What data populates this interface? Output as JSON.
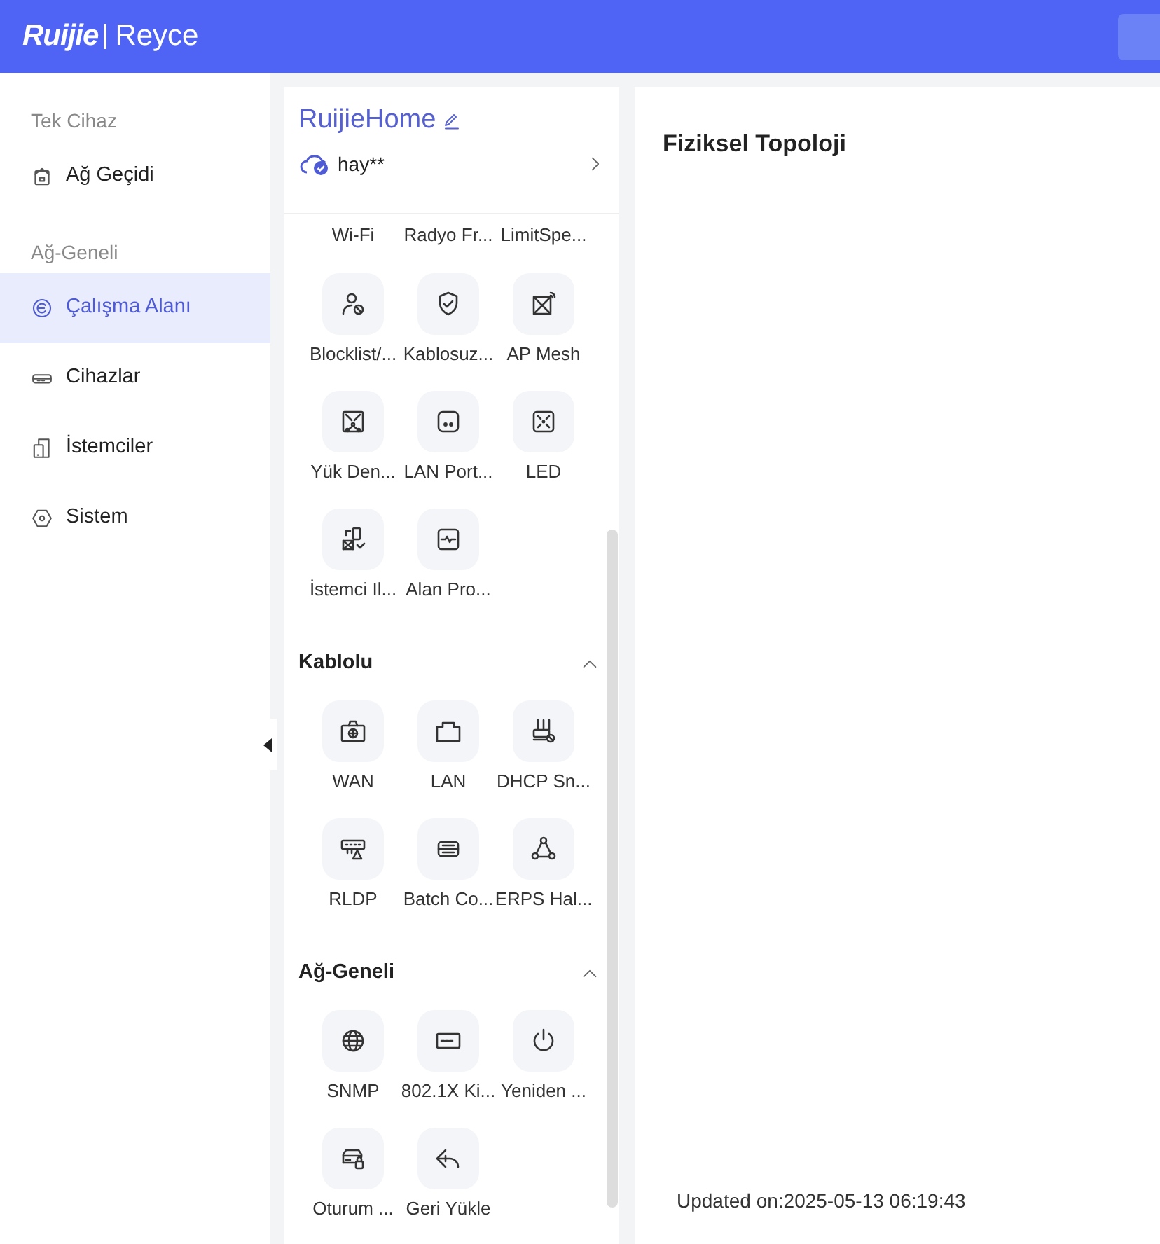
{
  "header": {
    "brand": "Ruijie",
    "product": "Reyce"
  },
  "sidebar": {
    "sections": [
      {
        "title": "Tek Cihaz",
        "items": [
          {
            "label": "Ağ Geçidi",
            "selected": false
          }
        ]
      },
      {
        "title": "Ağ-Geneli",
        "items": [
          {
            "label": "Çalışma Alanı",
            "selected": true
          },
          {
            "label": "Cihazlar",
            "selected": false
          },
          {
            "label": "İstemciler",
            "selected": false
          },
          {
            "label": "Sistem",
            "selected": false
          }
        ]
      }
    ]
  },
  "network": {
    "name": "RuijieHome",
    "account": "hay**"
  },
  "scrolled_labels": [
    "Wi-Fi",
    "Radyo Fr...",
    "LimitSpe..."
  ],
  "groups": [
    {
      "tiles": [
        "Blocklist/...",
        "Kablosuz...",
        "AP Mesh",
        "Yük Den...",
        "LAN Port...",
        "LED",
        "İstemci Il...",
        "Alan Pro..."
      ]
    },
    {
      "title": "Kablolu",
      "expanded": true,
      "tiles": [
        "WAN",
        "LAN",
        "DHCP Sn...",
        "RLDP",
        "Batch Co...",
        "ERPS Hal..."
      ]
    },
    {
      "title": "Ağ-Geneli",
      "expanded": true,
      "tiles": [
        "SNMP",
        "802.1X Ki...",
        "Yeniden ...",
        "Oturum ...",
        "Geri Yükle"
      ]
    }
  ],
  "main": {
    "title": "Fiziksel Topoloji",
    "updated": "Updated on:2025-05-13 06:19:43"
  }
}
